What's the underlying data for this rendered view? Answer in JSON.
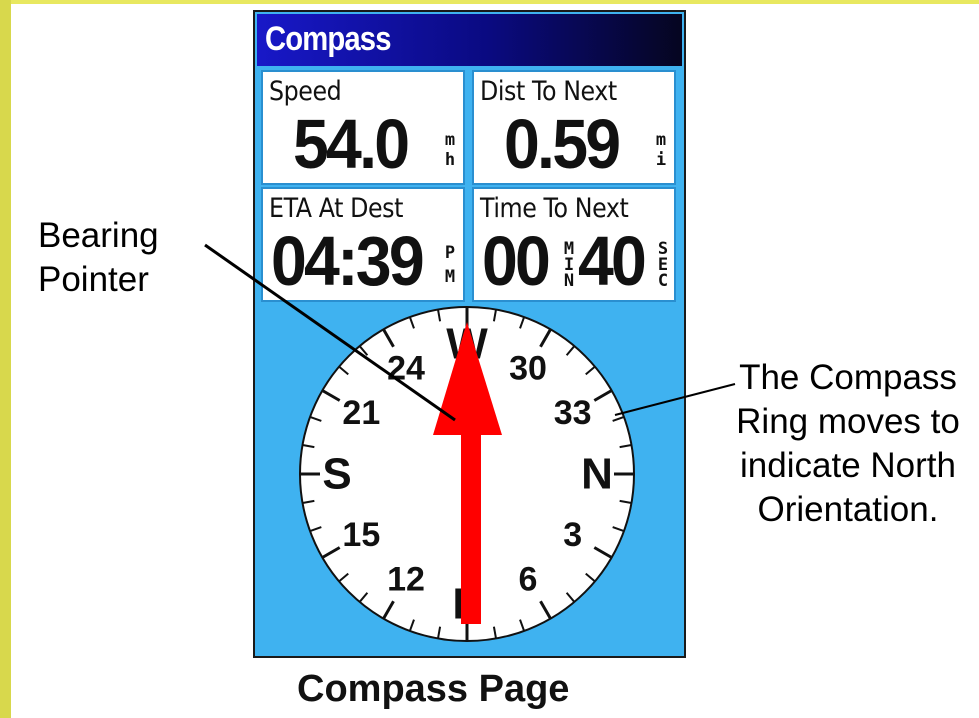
{
  "window": {
    "title": "Compass"
  },
  "fields": {
    "speed": {
      "label": "Speed",
      "value": "54.0",
      "unit_top": "m",
      "unit_bottom": "h"
    },
    "dist_to_next": {
      "label": "Dist To Next",
      "value": "0.59",
      "unit_top": "m",
      "unit_bottom": "i"
    },
    "eta_at_dest": {
      "label": "ETA At Dest",
      "value": "04:39",
      "unit_top": "P",
      "unit_bottom": "M"
    },
    "time_to_next": {
      "label": "Time To Next",
      "value1": "00",
      "unit1": [
        "M",
        "I",
        "N"
      ],
      "value2": "40",
      "unit2": [
        "S",
        "E",
        "C"
      ]
    }
  },
  "compass": {
    "ring_labels": [
      {
        "text": "W",
        "deg": 0,
        "bold": true
      },
      {
        "text": "30",
        "deg": 30
      },
      {
        "text": "33",
        "deg": 60
      },
      {
        "text": "N",
        "deg": 90,
        "bold": true
      },
      {
        "text": "3",
        "deg": 120
      },
      {
        "text": "6",
        "deg": 150
      },
      {
        "text": "E",
        "deg": 180,
        "bold": true
      },
      {
        "text": "12",
        "deg": 210
      },
      {
        "text": "15",
        "deg": 240
      },
      {
        "text": "S",
        "deg": 270,
        "bold": true
      },
      {
        "text": "21",
        "deg": 300
      },
      {
        "text": "24",
        "deg": 330
      }
    ],
    "pointer_color": "#ff0000",
    "background_color": "#3fb2f0"
  },
  "annotations": {
    "bearing_pointer": [
      "Bearing",
      "Pointer"
    ],
    "compass_ring": [
      "The Compass",
      "Ring moves to",
      "indicate North",
      "Orientation."
    ]
  },
  "caption": "Compass Page"
}
